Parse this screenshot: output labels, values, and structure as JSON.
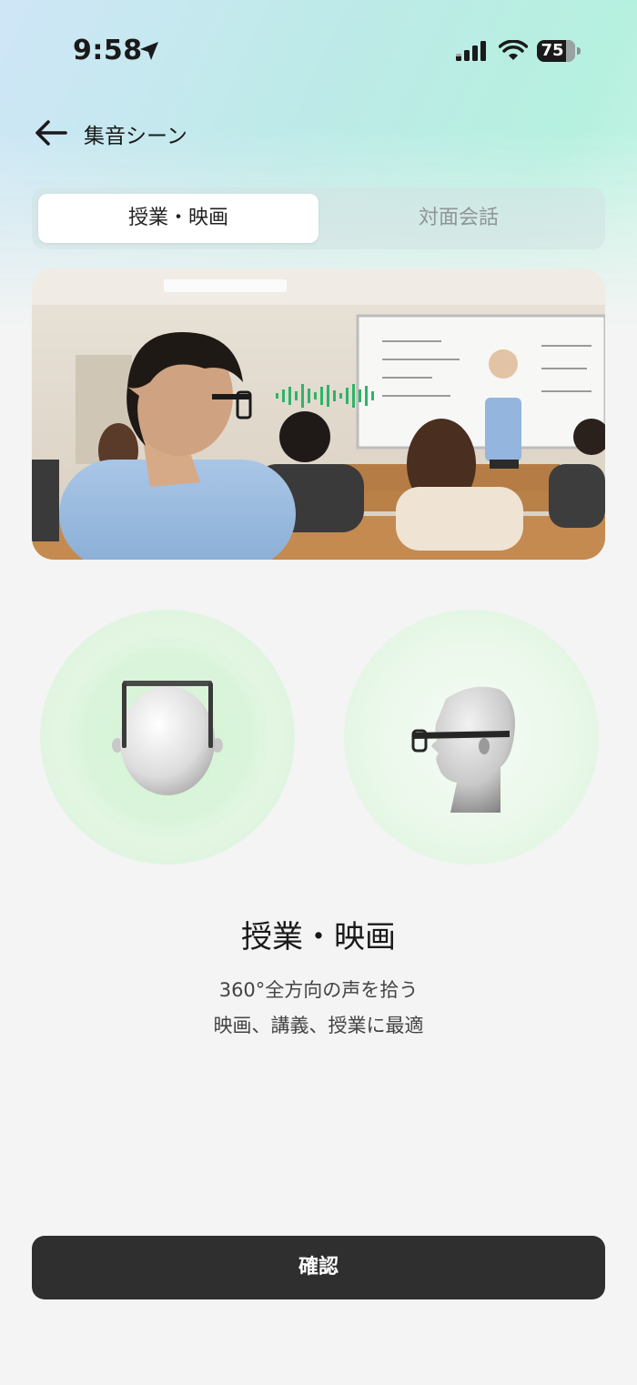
{
  "status_bar": {
    "time": "9:58",
    "battery": "75"
  },
  "header": {
    "title": "集音シーン"
  },
  "tabs": [
    {
      "label": "授業・映画",
      "selected": true
    },
    {
      "label": "対面会話",
      "selected": false
    }
  ],
  "scene": {
    "title": "授業・映画",
    "description_line1": "360°全方向の声を拾う",
    "description_line2": "映画、講義、授業に最適"
  },
  "confirm_button": {
    "label": "確認"
  },
  "colors": {
    "accent_green": "#2fb36a",
    "button_dark": "#2f2f2f",
    "bg": "#f4f4f4"
  }
}
